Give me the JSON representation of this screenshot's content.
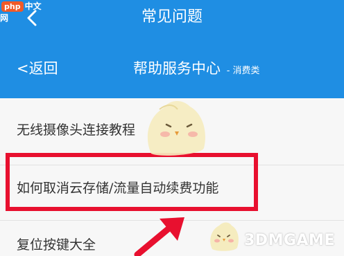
{
  "site_badge": {
    "prefix": "php",
    "text": "中文网"
  },
  "header": {
    "title": "常见问题"
  },
  "subheader": {
    "back_label": "<返回",
    "title": "帮助服务中心",
    "subtitle": "- 消费类"
  },
  "faq": {
    "items": [
      {
        "label": "无线摄像头连接教程"
      },
      {
        "label": "如何取消云存储/流量自动续费功能"
      },
      {
        "label": "复位按键大全"
      }
    ]
  },
  "watermark": {
    "text": "3DMGAME"
  },
  "colors": {
    "primary": "#1f8ee3",
    "highlight": "#e8102f",
    "mascot": "#f5ecbf"
  },
  "icons": {
    "back": "chevron-left-icon",
    "mascot": "mascot-chick-icon",
    "arrow": "arrow-up-right-icon"
  }
}
